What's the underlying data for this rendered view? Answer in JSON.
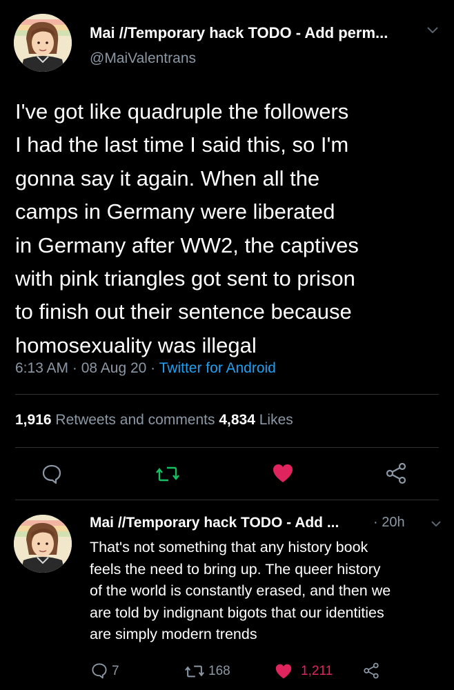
{
  "tweet": {
    "author_name": "Mai //Temporary hack TODO - Add perm...",
    "author_handle": "@MaiValentrans",
    "text_lines": [
      "I've got like quadruple the followers",
      "I had the last time I said this, so I'm",
      "gonna say it again. When all the",
      "camps in Germany were liberated",
      "in Germany after WW2, the captives",
      "with pink triangles got sent to prison",
      "to finish out their sentence because",
      "homosexuality was illegal"
    ],
    "time": "6:13 AM",
    "sep1": " · ",
    "date": "08 Aug 20",
    "sep2": " · ",
    "source": "Twitter for Android",
    "retweets_count": "1,916",
    "retweets_label": " Retweets and comments ",
    "likes_count": "4,834",
    "likes_label": " Likes"
  },
  "reply": {
    "author_name": "Mai //Temporary hack TODO - Add ...",
    "time": "· 20h",
    "text_lines": [
      "That's not something that any history book",
      "feels the need to bring up. The queer history",
      "of the world is constantly erased, and then we",
      "are told by indignant bigots that our identities",
      "are simply modern trends"
    ],
    "reply_count": "7",
    "retweet_count": "168",
    "like_count": "1,211"
  },
  "icons": {
    "reply": "speech-bubble-icon",
    "retweet": "retweet-icon",
    "like": "heart-icon",
    "share": "share-icon",
    "menu": "chevron-down-icon"
  },
  "colors": {
    "background": "#000000",
    "text": "#ffffff",
    "muted": "#8b98a5",
    "link": "#1da1f2",
    "retweet": "#17bf63",
    "like": "#e0245e"
  }
}
